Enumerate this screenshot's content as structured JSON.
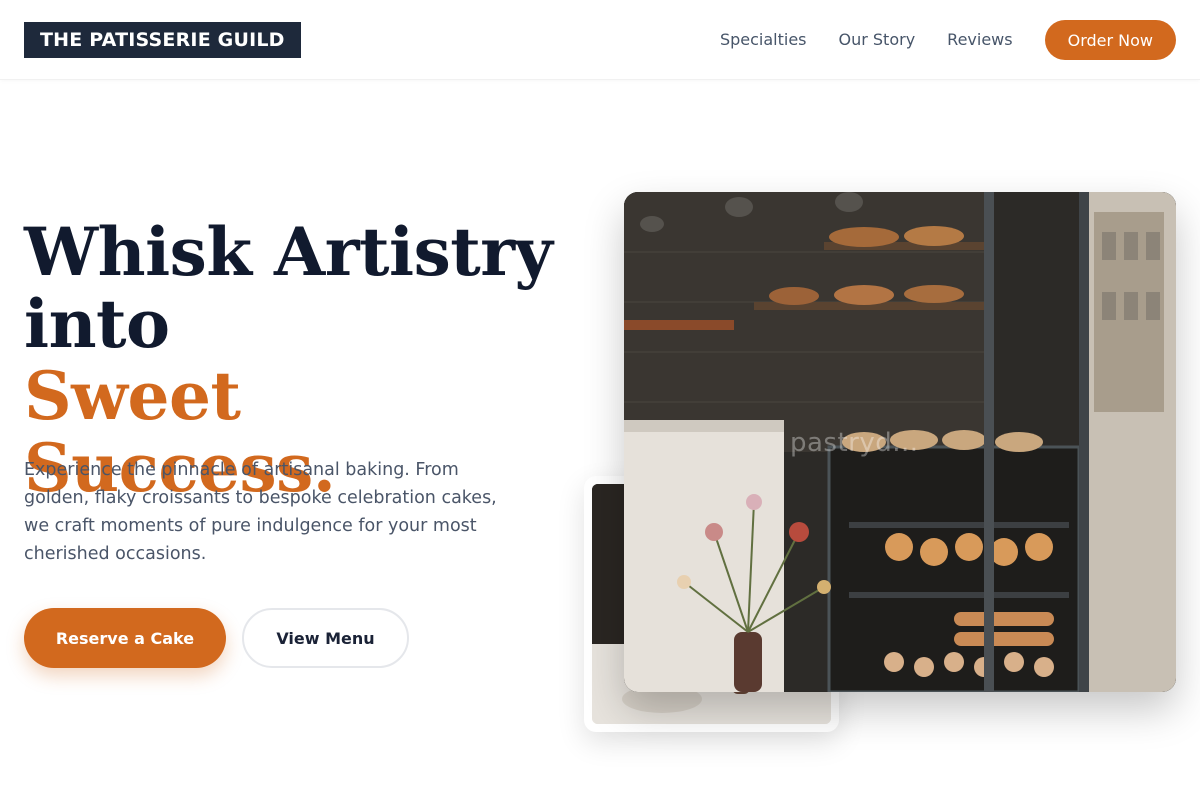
{
  "header": {
    "logo": "THE PATISSERIE GUILD",
    "nav": [
      "Specialties",
      "Our Story",
      "Reviews"
    ],
    "cta": "Order Now"
  },
  "hero": {
    "headline_line1": "Whisk Artistry",
    "headline_line2": "into",
    "headline_accent": "Sweet Success.",
    "description": "Experience the pinnacle of artisanal baking. From golden, flaky croissants to bespoke celebration cakes, we craft moments of pure indulgence for your most cherished occasions.",
    "primary_button": "Reserve a Cake",
    "secondary_button": "View Menu"
  },
  "image": {
    "watermark": "pastryd..."
  },
  "colors": {
    "accent": "#d2691e",
    "navy": "#1e293b",
    "text": "#4a5568"
  }
}
